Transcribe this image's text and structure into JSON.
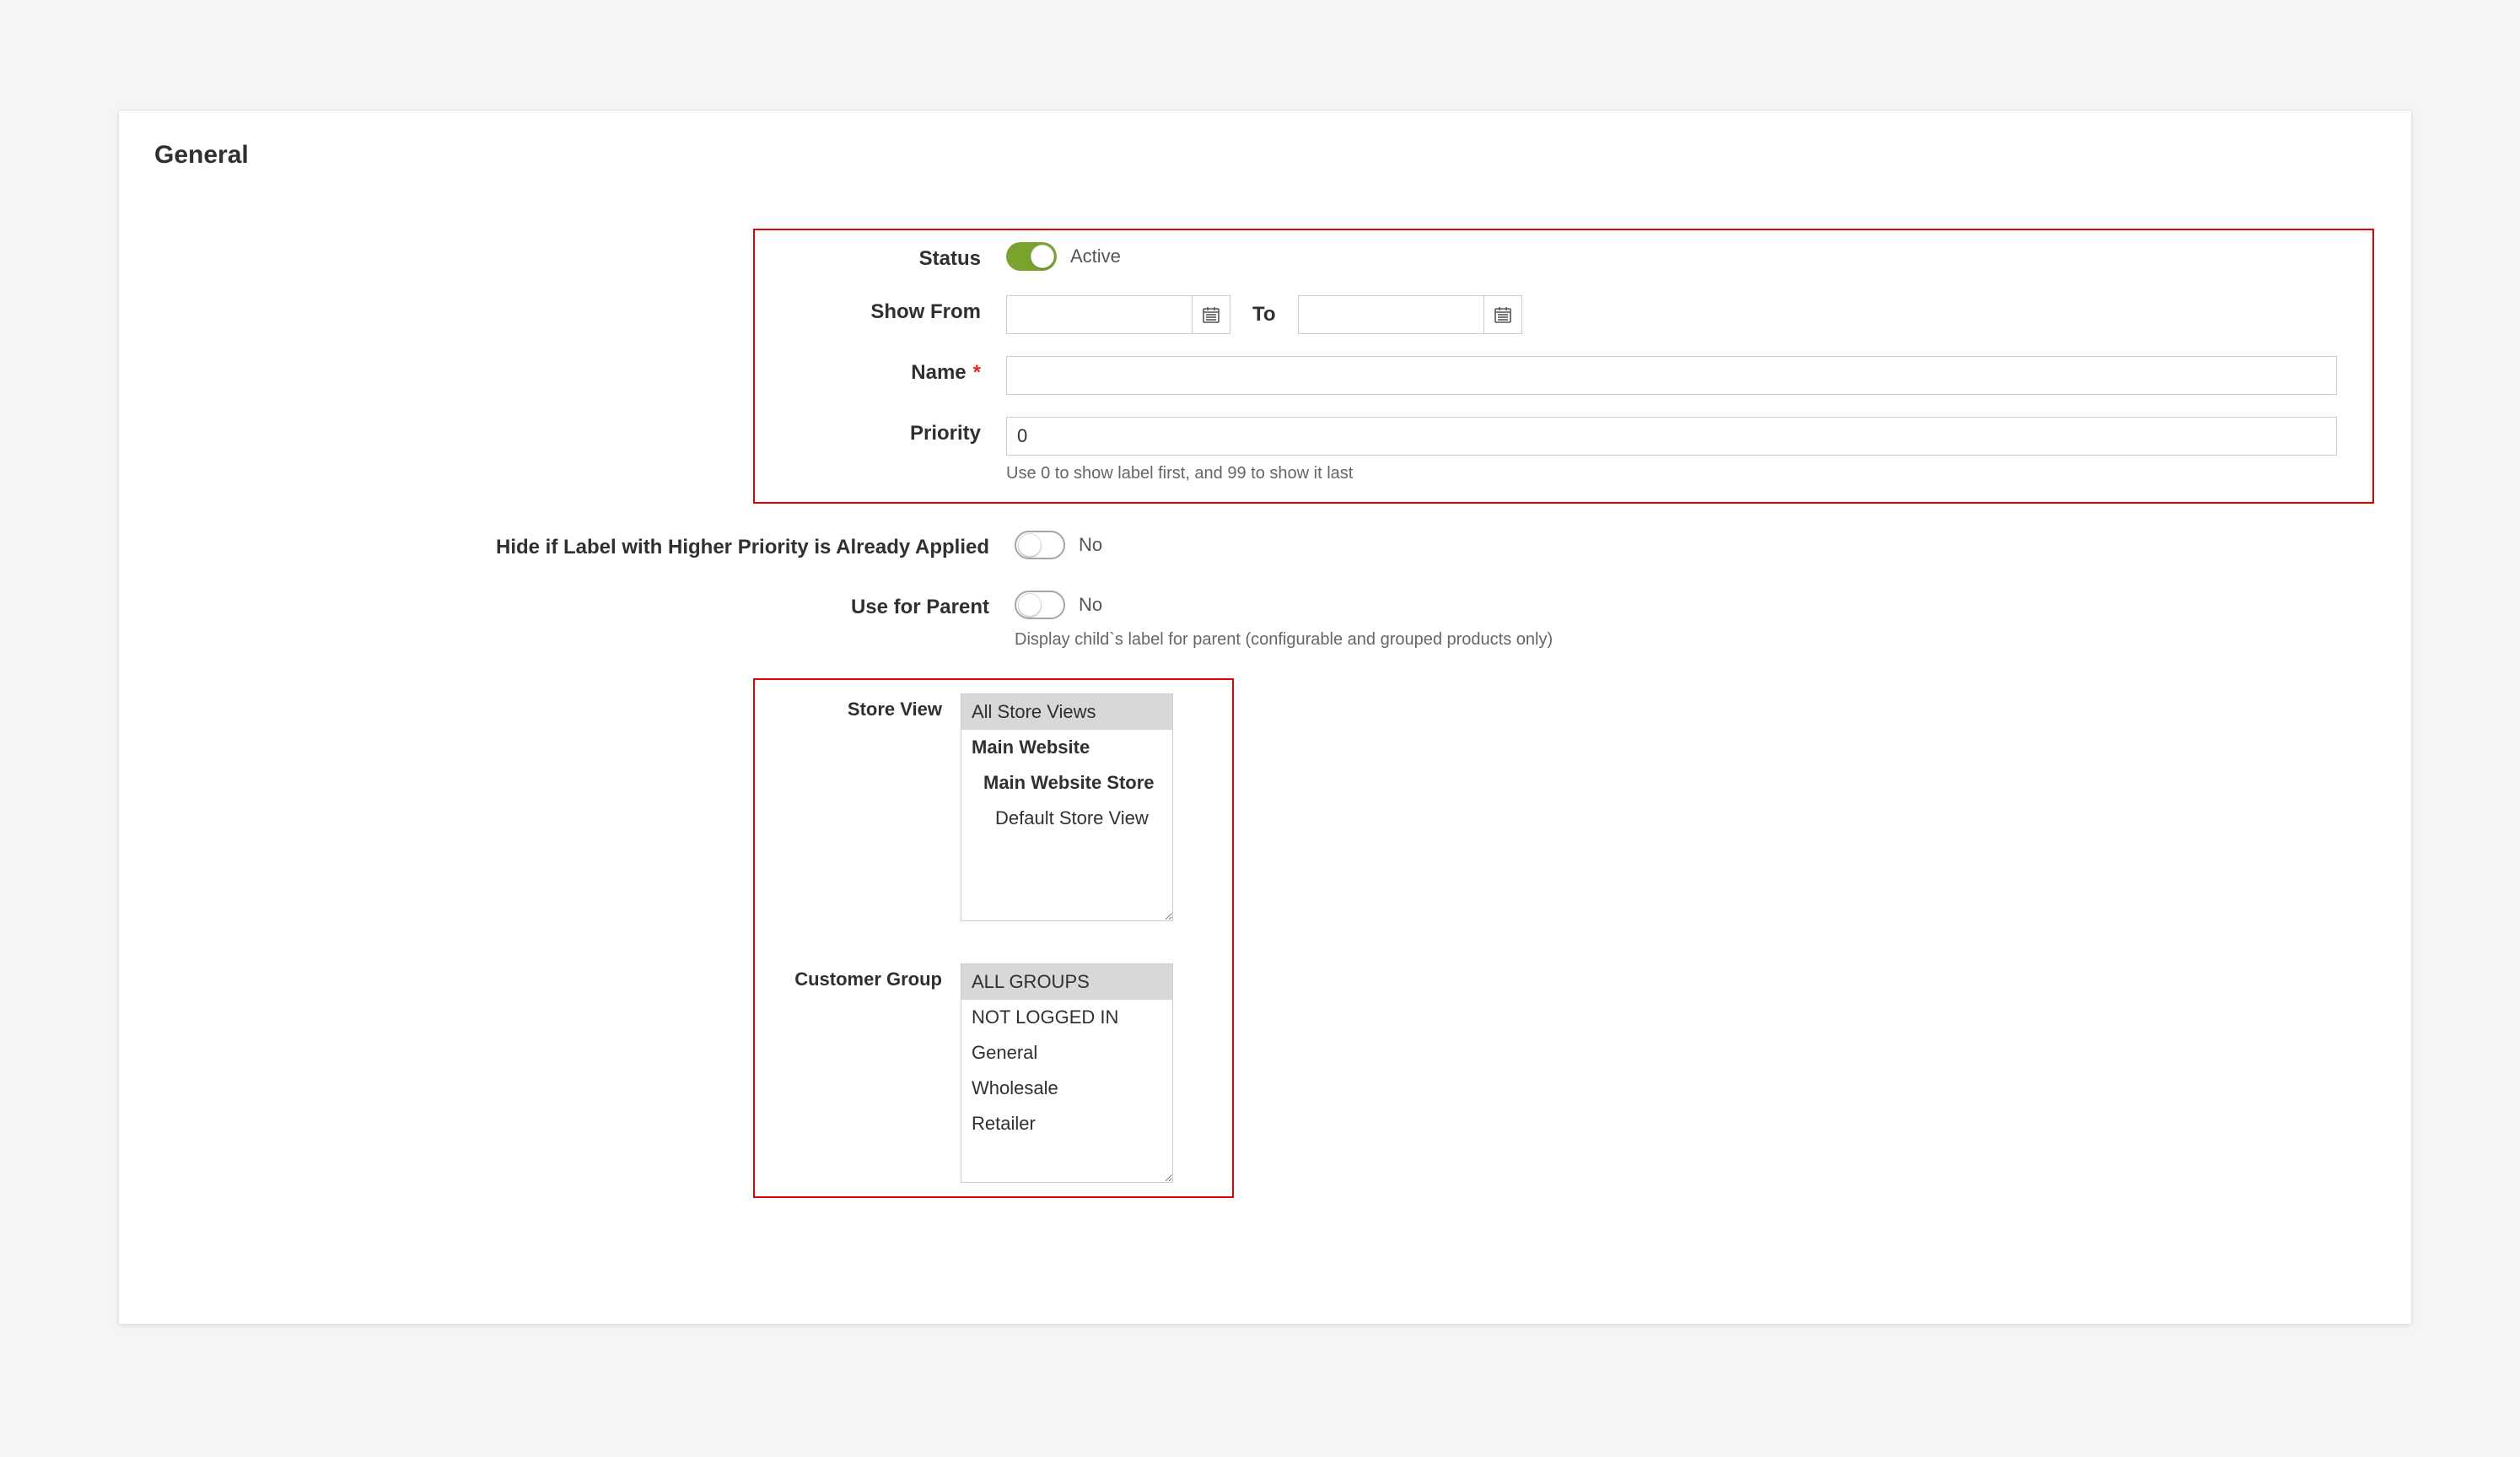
{
  "section_title": "General",
  "fields": {
    "status": {
      "label": "Status",
      "state_text": "Active",
      "on": true
    },
    "show_from": {
      "label": "Show From",
      "value": ""
    },
    "show_to": {
      "label": "To",
      "value": ""
    },
    "name": {
      "label": "Name",
      "value": "",
      "required": true
    },
    "priority": {
      "label": "Priority",
      "value": "0",
      "note": "Use 0 to show label first, and 99 to show it last"
    },
    "hide_if_higher": {
      "label": "Hide if Label with Higher Priority is Already Applied",
      "state_text": "No",
      "on": false
    },
    "use_for_parent": {
      "label": "Use for Parent",
      "state_text": "No",
      "on": false,
      "note": "Display child`s label for parent (configurable and grouped products only)"
    },
    "store_view": {
      "label": "Store View",
      "options": [
        {
          "text": "All Store Views",
          "selected": true,
          "bold": false,
          "indent": 0
        },
        {
          "text": "Main Website",
          "selected": false,
          "bold": true,
          "indent": 0
        },
        {
          "text": "Main Website Store",
          "selected": false,
          "bold": true,
          "indent": 1
        },
        {
          "text": "Default Store View",
          "selected": false,
          "bold": false,
          "indent": 2
        }
      ]
    },
    "customer_group": {
      "label": "Customer Group",
      "options": [
        {
          "text": "ALL GROUPS",
          "selected": true
        },
        {
          "text": "NOT LOGGED IN",
          "selected": false
        },
        {
          "text": "General",
          "selected": false
        },
        {
          "text": "Wholesale",
          "selected": false
        },
        {
          "text": "Retailer",
          "selected": false
        }
      ]
    }
  }
}
